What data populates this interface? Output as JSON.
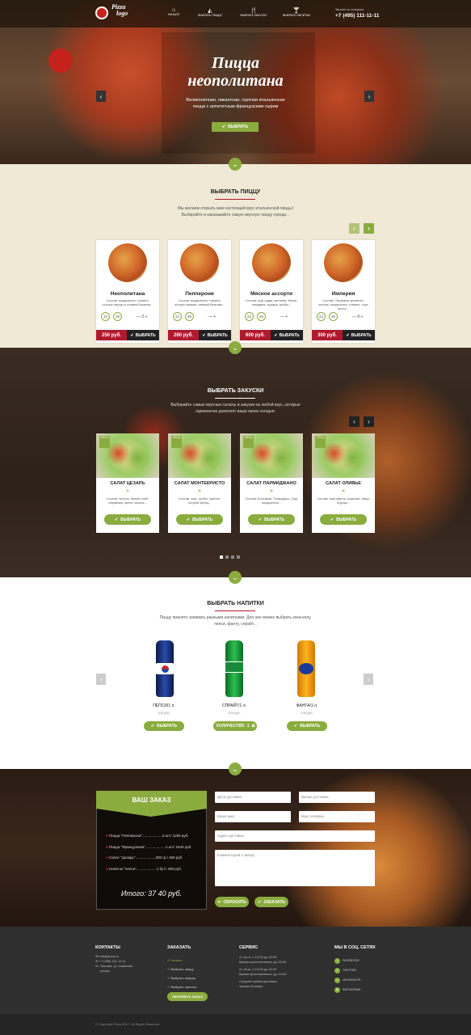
{
  "header": {
    "logo_line1": "Pizza",
    "logo_line2": "logo",
    "nav": [
      "НАЧАЛО",
      "ВЫБРАТЬ ПИЦЦУ",
      "ВЫБРАТЬ ЗАКУСКУ",
      "ВЫБРАТЬ НАПИТКИ"
    ],
    "phone_label": "Звоните по телефону:",
    "phone": "+7 (495) 111-11-11"
  },
  "hero": {
    "title1": "Пицца",
    "title2": "неополитана",
    "text1": "Великолепная, пикантная, горячая итальянская",
    "text2": "пицца с аппетитным французским сыром",
    "button": "ВЫБРАТЬ"
  },
  "pizza_section": {
    "title": "ВЫБРАТЬ ПИЦЦУ",
    "text1": "Мы желаем открыть вам настоящий вкус итальянской пиццы!",
    "text2": "Выбирайте и заказывайте самую вкусную пиццу города...",
    "sizes": [
      "22",
      "35"
    ],
    "items": [
      {
        "name": "Неополитана",
        "desc": "Состав: моцарелла, томаты, острые перцы и оливки Базилик...",
        "qty": "2",
        "price": "250 руб.",
        "button": "ВЫБРАТЬ"
      },
      {
        "name": "Пепперони",
        "desc": "Состав: моцарелла, томаты, острая салями, свежий базилик...",
        "qty": "",
        "price": "260 руб.",
        "button": "ВЫБРАТЬ"
      },
      {
        "name": "Мясное ассорти",
        "desc": "Состав: сыр гауда, ветчина, бекон, говядина, курица, грибы...",
        "qty": "",
        "price": "600 руб.",
        "button": "ВЫБРАТЬ"
      },
      {
        "name": "Империя",
        "desc": "Состав: Тигровые креветки, чеснок, моцарелла, томаты, соус песто...",
        "qty": "0",
        "price": "300 руб.",
        "button": "ВЫБРАТЬ"
      }
    ]
  },
  "snack_section": {
    "title": "ВЫБРАТЬ ЗАКУСКИ",
    "text1": "Выбирайте самые вкусные салаты и закуски на любой вкус, которые",
    "text2": "гармонично дополнят ваше меню сегодня.",
    "items": [
      {
        "badge": "150 гр",
        "name": "САЛАТ ЦЕЗАРЬ",
        "desc": "Состав: чеснок, белый хлеб, пармезан, филе лосося...",
        "button": "ВЫБРАТЬ"
      },
      {
        "badge": "190 гр",
        "name": "САЛАТ МОНТЕКРИСТО",
        "desc": "Состав: сыр, грибы, черное, острый перец...",
        "button": "ВЫБРАТЬ"
      },
      {
        "badge": "150 гр",
        "name": "САЛАТ ПАРМИДЖАНО",
        "desc": "Состав: Болгария, Помидоры, Сыр моцарелла...",
        "button": "ВЫБРАТЬ"
      },
      {
        "badge": "170 гр",
        "name": "САЛАТ ОЛИВЬЕ",
        "desc": "Состав: картофель, морковь, яйца, огурцы...",
        "button": "ВЫБРАТЬ"
      }
    ]
  },
  "drink_section": {
    "title": "ВЫБРАТЬ НАПИТКИ",
    "text1": "Пиццу принято запивать разными напитками. Для нее можно выбрать кока-колу,",
    "text2": "пепси, фанту, спрайт...",
    "items": [
      {
        "name": "ПЕПСИ/1 л.",
        "price": "100 руб.",
        "button": "ВЫБРАТЬ",
        "color": "#1a3a8a"
      },
      {
        "name": "СПРАЙТ/1 л.",
        "price": "100 руб.",
        "button": "КОЛИЧЕСТВО",
        "qty": "1",
        "color": "#1f9a3a"
      },
      {
        "name": "ФАНТА/1 л.",
        "price": "100 руб.",
        "button": "ВЫБРАТЬ",
        "color": "#f59c0f"
      }
    ]
  },
  "order_section": {
    "title": "ВАШ ЗАКАЗ",
    "lines": [
      "Пицца \"Пепперони\"....................3 шт./ 1250 руб.",
      "Пицца \"Французская\"....................1 шт./ 1540 руб.",
      "Салат \"Цезарь\"....................200 гр./ 460 руб.",
      "Напиток \"пепси\"....................1 бут./ 400 руб."
    ],
    "total": "Итого: 37 40 руб.",
    "fields": {
      "date": "Дата доставки",
      "time": "Время доставки",
      "name": "Ваше имя",
      "phone": "Ваш телефон",
      "address": "Адрес доставки",
      "comment": "Комментарий к заказу"
    },
    "reset": "СБРОСИТЬ",
    "submit": "ЗАКАЗАТЬ"
  },
  "footer": {
    "contacts_title": "КОНТАКТЫ",
    "email": "info@pizza.ru",
    "phone": "+7 (495) 111-11-11",
    "address1": "г. Москва, ул. название",
    "address2": "улицы",
    "order_title": "ЗАКАЗАТЬ",
    "order_links": [
      "Начало",
      "Выбрать пиццу",
      "Выбрать закуску",
      "Выбрать напитки"
    ],
    "order_button": "ОФОРМИТЬ ЗАКАЗ",
    "service_title": "СЕРВИС",
    "service1a": "пн-пт: с 10:00 до 22:00",
    "service1b": "Время приготовления: до 20:00",
    "service2a": "сб-вс: с 10:00 до 22:00",
    "service2b": "Время приготовления: до 20:00",
    "service3a": "Среднее время доставки",
    "service3b": "заказа 45 минут",
    "social_title": "МЫ В СОЦ. СЕТЯХ",
    "social": [
      "FACEBOOK",
      "TWITTER",
      "VKONTAKTE",
      "INSTAGRAM"
    ],
    "copyright": "© Copyright Pizza 2017. All Rights Reserved"
  }
}
